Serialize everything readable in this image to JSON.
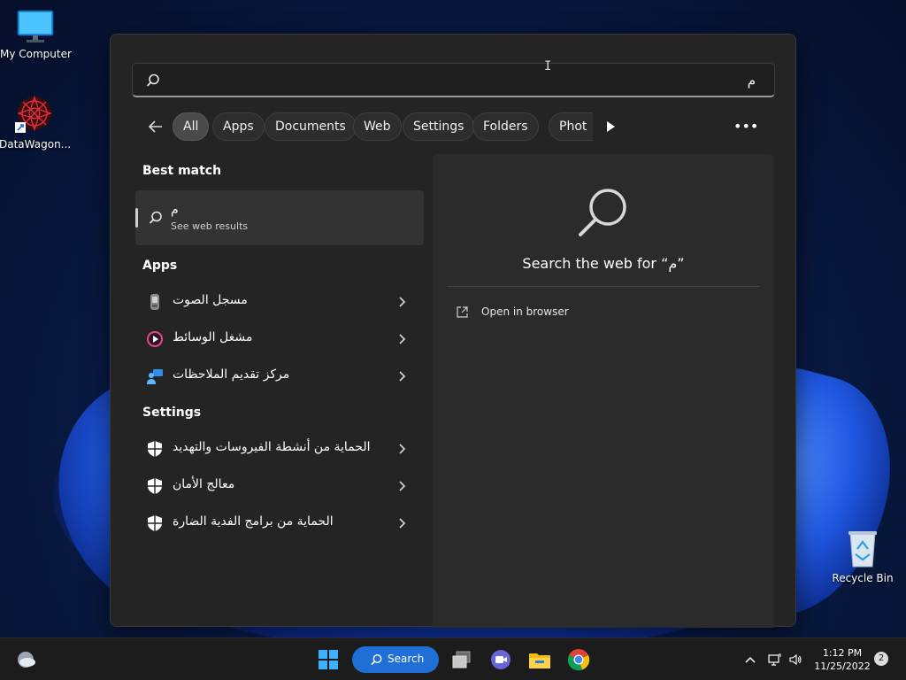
{
  "desktop": {
    "icons": [
      {
        "label": "My Computer"
      },
      {
        "label": "DataWagon..."
      },
      {
        "label": "Recycle Bin"
      }
    ]
  },
  "search": {
    "value": "م",
    "placeholder": ""
  },
  "filters": {
    "chips": [
      "All",
      "Apps",
      "Documents",
      "Web",
      "Settings",
      "Folders",
      "Phot"
    ],
    "active": "All"
  },
  "best_match": {
    "heading": "Best match",
    "title": "م",
    "subtitle": "See web results"
  },
  "apps": {
    "heading": "Apps",
    "items": [
      {
        "label": "مسجل الصوت",
        "icon": "voice-recorder-icon"
      },
      {
        "label": "مشغل الوسائط",
        "icon": "media-player-icon"
      },
      {
        "label": "مركز تقديم الملاحظات",
        "icon": "feedback-hub-icon"
      }
    ]
  },
  "settings": {
    "heading": "Settings",
    "items": [
      {
        "label": "الحماية من أنشطة الفيروسات والتهديد",
        "icon": "shield-icon"
      },
      {
        "label": "معالج الأمان",
        "icon": "shield-icon"
      },
      {
        "label": "الحماية من برامج الفدية الضارة",
        "icon": "shield-icon"
      }
    ]
  },
  "preview": {
    "title": "Search the web for “م”",
    "open_in_browser": "Open in browser"
  },
  "taskbar": {
    "search_label": "Search",
    "time": "1:12 PM",
    "date": "11/25/2022",
    "notifications": "2"
  },
  "colors": {
    "panel_bg": "#242424",
    "accent": "#1f6fd6",
    "taskbar_bg": "#1c1c1c"
  }
}
